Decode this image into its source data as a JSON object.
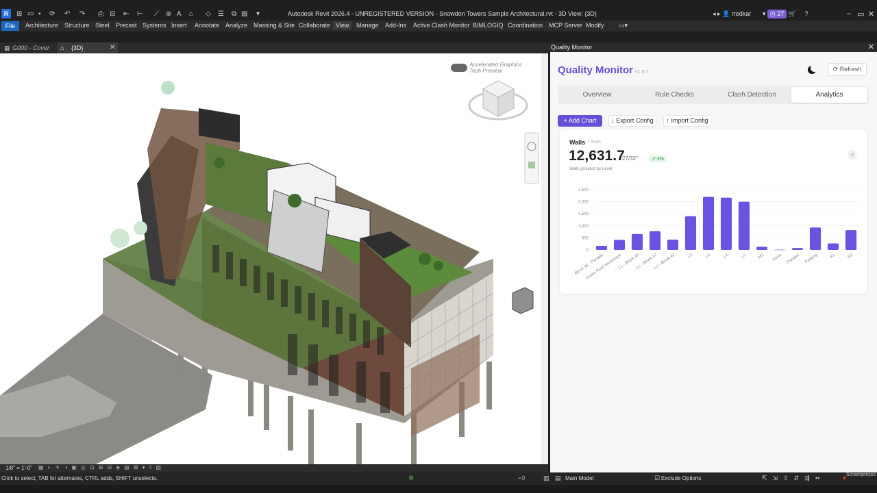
{
  "window": {
    "title": "Autodesk Revit 2026.4 - UNREGISTERED VERSION - Snowdon Towers Sample Architectural.rvt - 3D View: {3D}",
    "app_logo": "R",
    "user": "rredkar",
    "notification_count": "27"
  },
  "ribbon": {
    "file": "File",
    "tabs": [
      "Architecture",
      "Structure",
      "Steel",
      "Precast",
      "Systems",
      "Insert",
      "Annotate",
      "Analyze",
      "Massing & Site",
      "Collaborate",
      "View",
      "Manage",
      "Add-Ins",
      "Active Clash Monitor",
      "BIMLOGIQ",
      "Coordination",
      "MCP Server",
      "Modify"
    ]
  },
  "view_tabs": {
    "tab1": "G000 - Cover",
    "tab2": "{3D}"
  },
  "viewport": {
    "accel_line1": "Accelerated Graphics",
    "accel_line2": "Tech Preview",
    "scale": "1/8\" = 1'-0\""
  },
  "status": {
    "hint": "Click to select, TAB for alternates, CTRL adds, SHIFT unselects.",
    "model": "Main Model",
    "exclude": "Exclude Options"
  },
  "panel": {
    "window_title": "Quality Monitor",
    "title": "Quality Monitor",
    "version": "v1.3.7",
    "refresh": "Refresh",
    "tabs": [
      "Overview",
      "Rule Checks",
      "Clash Detection",
      "Analytics"
    ],
    "active_tab": "Analytics",
    "add_chart": "+ Add Chart",
    "export_config": "↓ Export Config",
    "import_config": "↑ Import Config",
    "card": {
      "title": "Walls",
      "aggregation": "• Sum",
      "value": "12,631.7",
      "fraction": "27/32\"",
      "badge": "↗ 3%",
      "subtitle": "Walls grouped by Level",
      "close": "×"
    }
  },
  "chart_data": {
    "type": "bar",
    "categories": [
      "Block 35 - Parapet",
      "Green Roof Hardscape",
      "L1 - Block 35",
      "L1 - Block 37",
      "L1 - Block 43",
      "L2",
      "L3",
      "L4",
      "L5",
      "M1",
      "None",
      "Parapet",
      "Parking",
      "R1",
      "R2"
    ],
    "values": [
      170,
      420,
      660,
      780,
      430,
      1400,
      2200,
      2170,
      2000,
      130,
      10,
      80,
      930,
      270,
      820
    ],
    "yticks": [
      "0",
      "500",
      "1,000",
      "1,500",
      "2,000",
      "2,500"
    ],
    "ylim": [
      0,
      2500
    ],
    "color": "#6b52e0"
  },
  "watermark": "Screenpresso"
}
